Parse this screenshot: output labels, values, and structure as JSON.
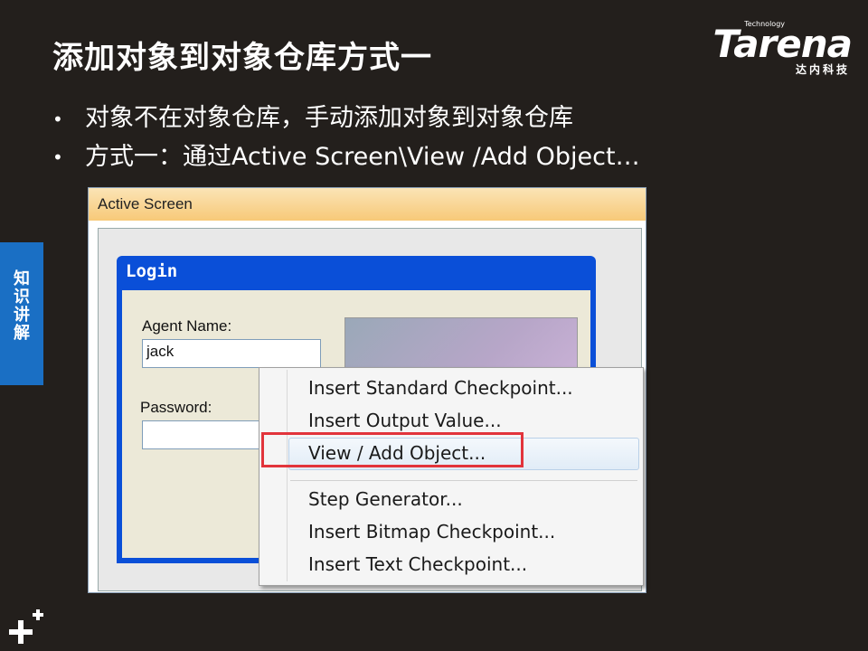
{
  "slide": {
    "title": "添加对象到对象仓库方式一",
    "bullets": [
      "对象不在对象仓库，手动添加对象到对象仓库",
      "方式一：通过Active Screen\\View /Add Object…"
    ],
    "side_tab": "知识讲解",
    "logo": {
      "brand": "Tarena",
      "tagline": "Technology",
      "cn": "达内科技"
    }
  },
  "screenshot": {
    "panel_title": "Active Screen",
    "login_window": {
      "title": "Login",
      "agent_name_label": "Agent Name:",
      "agent_name_value": "jack",
      "password_label": "Password:",
      "password_value": ""
    },
    "context_menu": {
      "items": [
        "Insert Standard Checkpoint...",
        "Insert Output Value...",
        "View / Add Object...",
        "Step Generator...",
        "Insert Bitmap Checkpoint...",
        "Insert Text Checkpoint..."
      ],
      "highlighted_item": "View / Add Object..."
    }
  },
  "colors": {
    "background": "#231f1c",
    "side_tab": "#1a6fc4",
    "highlight_border": "#e2343b",
    "login_titlebar": "#0a4fd8"
  }
}
